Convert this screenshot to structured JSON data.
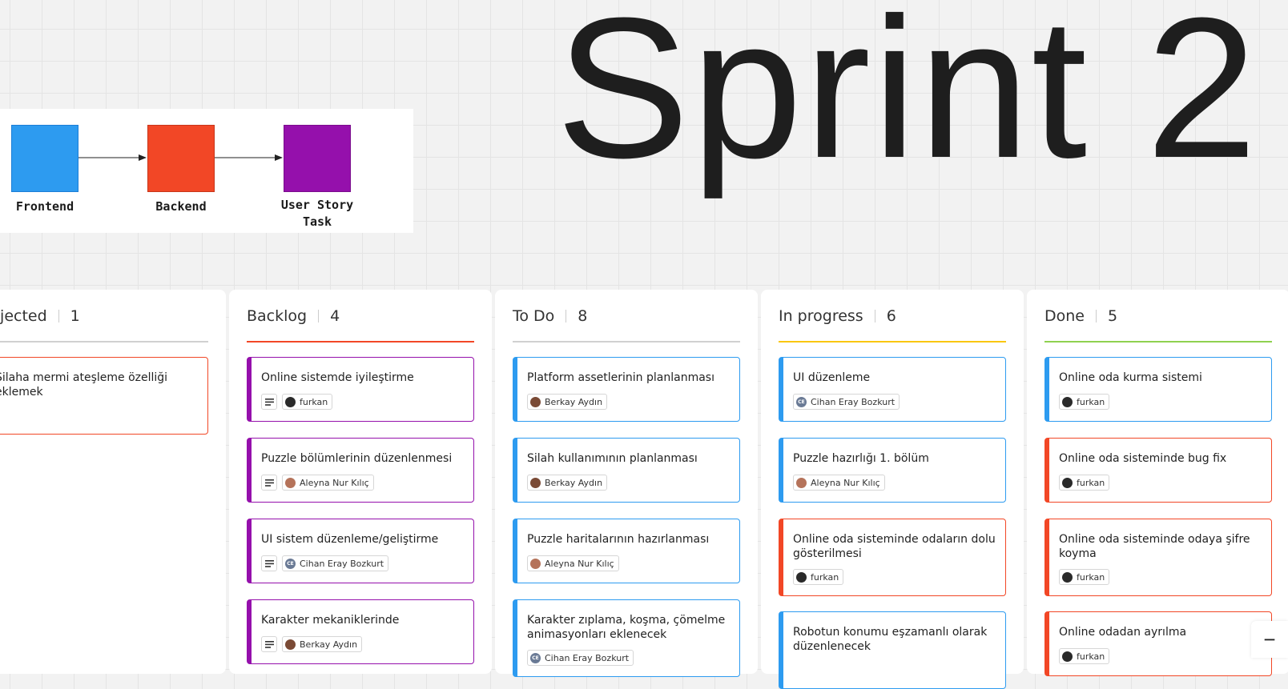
{
  "board": {
    "title": "Sprint 2",
    "legend": [
      {
        "label": "Frontend",
        "color": "#2d9bf0"
      },
      {
        "label": "Backend",
        "color": "#f24726"
      },
      {
        "label": "User Story Task",
        "color": "#9510ac"
      }
    ]
  },
  "columns": [
    {
      "name": "Rejected",
      "count": "1",
      "accent": "#d0d0d0",
      "cards": [
        {
          "title": "Silaha mermi ateşleme özelliği eklemek",
          "color": "#f24726",
          "desc": false,
          "assignee": null
        }
      ]
    },
    {
      "name": "Backlog",
      "count": "4",
      "accent": "#f24726",
      "cards": [
        {
          "title": "Online sistemde iyileştirme",
          "color": "#9510ac",
          "desc": true,
          "assignee": "furkan"
        },
        {
          "title": "Puzzle bölümlerinin düzenlenmesi",
          "color": "#9510ac",
          "desc": true,
          "assignee": "Aleyna Nur Kılıç"
        },
        {
          "title": "UI sistem düzenleme/geliştirme",
          "color": "#9510ac",
          "desc": true,
          "assignee": "Cihan Eray Bozkurt"
        },
        {
          "title": "Karakter mekaniklerinde",
          "color": "#9510ac",
          "desc": true,
          "assignee": "Berkay Aydın"
        }
      ]
    },
    {
      "name": "To Do",
      "count": "8",
      "accent": "#d0d0d0",
      "cards": [
        {
          "title": "Platform assetlerinin planlanması",
          "color": "#2d9bf0",
          "desc": false,
          "assignee": "Berkay Aydın"
        },
        {
          "title": "Silah kullanımının planlanması",
          "color": "#2d9bf0",
          "desc": false,
          "assignee": "Berkay Aydın"
        },
        {
          "title": "Puzzle haritalarının hazırlanması",
          "color": "#2d9bf0",
          "desc": false,
          "assignee": "Aleyna Nur Kılıç"
        },
        {
          "title": "Karakter zıplama, koşma, çömelme animasyonları eklenecek",
          "color": "#2d9bf0",
          "desc": false,
          "assignee": "Cihan Eray Bozkurt"
        }
      ]
    },
    {
      "name": "In progress",
      "count": "6",
      "accent": "#fac710",
      "cards": [
        {
          "title": "UI düzenleme",
          "color": "#2d9bf0",
          "desc": false,
          "assignee": "Cihan Eray Bozkurt"
        },
        {
          "title": "Puzzle hazırlığı 1. bölüm",
          "color": "#2d9bf0",
          "desc": false,
          "assignee": "Aleyna Nur Kılıç"
        },
        {
          "title": "Online oda sisteminde odaların dolu gösterilmesi",
          "color": "#f24726",
          "desc": false,
          "assignee": "furkan"
        },
        {
          "title": "Robotun konumu eşzamanlı olarak düzenlenecek",
          "color": "#2d9bf0",
          "desc": false,
          "assignee": null
        }
      ]
    },
    {
      "name": "Done",
      "count": "5",
      "accent": "#8fd14f",
      "cards": [
        {
          "title": "Online oda kurma sistemi",
          "color": "#2d9bf0",
          "desc": false,
          "assignee": "furkan"
        },
        {
          "title": "Online oda sisteminde bug fix",
          "color": "#f24726",
          "desc": false,
          "assignee": "furkan"
        },
        {
          "title": "Online oda sisteminde odaya şifre koyma",
          "color": "#f24726",
          "desc": false,
          "assignee": "furkan"
        },
        {
          "title": "Online odadan ayrılma",
          "color": "#f24726",
          "desc": false,
          "assignee": "furkan"
        }
      ]
    }
  ],
  "avatars": {
    "furkan": {
      "initials": "",
      "color": "#2a2a2a"
    },
    "Berkay Aydın": {
      "initials": "",
      "color": "#7a4a35"
    },
    "Aleyna Nur Kılıç": {
      "initials": "",
      "color": "#b5735a"
    },
    "Cihan Eray Bozkurt": {
      "initials": "CE",
      "color": "#6a7a95"
    }
  },
  "zoom": {
    "out_label": "−"
  }
}
